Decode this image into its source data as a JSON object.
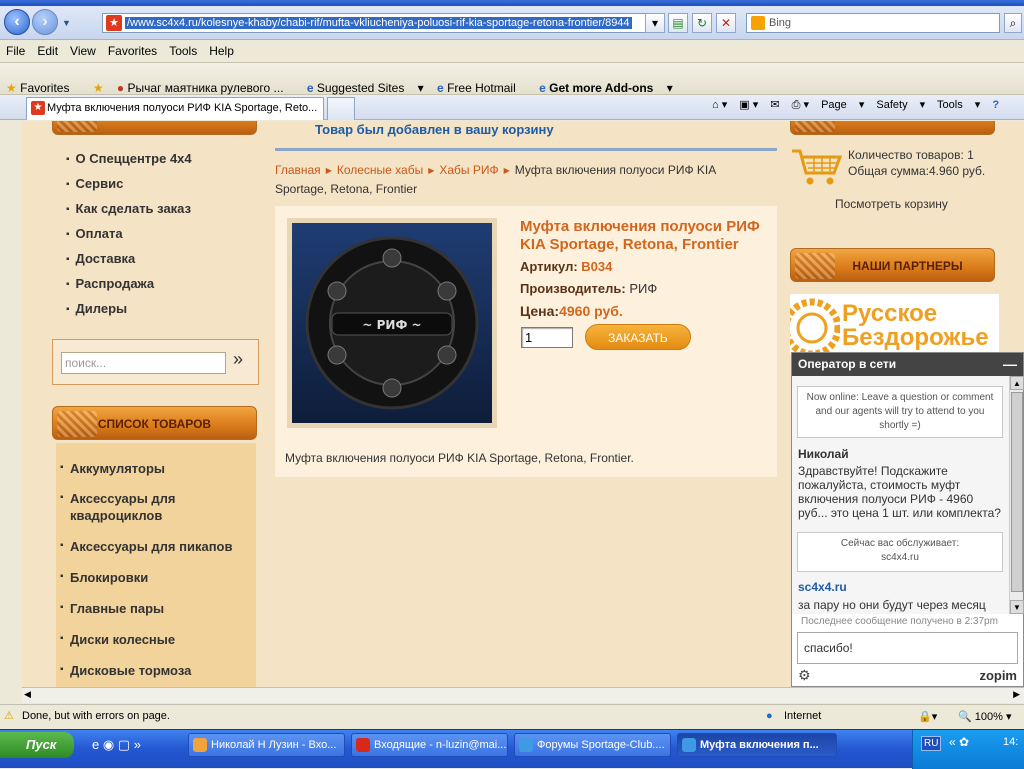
{
  "browser": {
    "url_prefix": "/www.sc4x4.ru/kolesnye-khaby/chabi-rif/mufta-vkliucheniya-poluosi-rif-kia-sportage-retona-frontier/8944",
    "search_placeholder": "Bing",
    "menu": [
      "File",
      "Edit",
      "View",
      "Favorites",
      "Tools",
      "Help"
    ],
    "favorites": {
      "favorites_label": "Favorites",
      "items": [
        "Рычаг маятника рулевого ...",
        "Suggested Sites",
        "Free Hotmail",
        "Get more Add-ons"
      ]
    },
    "tab_title": "Муфта включения полуоси РИФ KIA Sportage, Reto...",
    "commands": [
      "Page",
      "Safety",
      "Tools"
    ]
  },
  "site": {
    "left_nav": [
      "О Спеццентре 4х4",
      "Сервис",
      "Как сделать заказ",
      "Оплата",
      "Доставка",
      "Распродажа",
      "Дилеры"
    ],
    "search_placeholder": "поиск...",
    "search_go": "»",
    "goods_header": "СПИСОК ТОВАРОВ",
    "goods": [
      "Аккумуляторы",
      "Аксессуары для квадроциклов",
      "Аксессуары для пикапов",
      "Блокировки",
      "Главные пары",
      "Диски колесные",
      "Дисковые тормоза"
    ],
    "cart_added": "Товар был добавлен в вашу корзину",
    "breadcrumbs": [
      "Главная",
      "Колесные хабы",
      "Хабы РИФ"
    ],
    "breadcrumb_current": "Муфта включения полуоси РИФ KIA Sportage, Retona, Frontier",
    "product": {
      "title": "Муфта включения полуоси РИФ KIA Sportage, Retona, Frontier",
      "sku_label": "Артикул:",
      "sku": "B034",
      "maker_label": "Производитель:",
      "maker": "РИФ",
      "price_label": "Цена:",
      "price": "4960 руб.",
      "qty": "1",
      "order_button": "ЗАКАЗАТЬ",
      "description": "Муфта включения полуоси РИФ KIA Sportage, Retona, Frontier.",
      "image_text": "~ РИФ ~"
    },
    "cart": {
      "count": "Количество товаров: 1",
      "total": "Общая сумма:4.960 руб.",
      "view_cart": "Посмотреть корзину"
    },
    "partners_header": "НАШИ ПАРТНЕРЫ",
    "partner_banner_line1": "Русское",
    "partner_banner_line2": "Бездорожье"
  },
  "chat": {
    "header": "Оператор в сети",
    "intro": "Now online: Leave a question or comment and our agents will try to attend to you shortly =)",
    "user_name": "Николай",
    "user_message": "Здравствуйте! Подскажите пожалуйста, стоимость муфт включения полуоси РИФ - 4960 руб... это цена 1 шт. или комплекта?",
    "served_label": "Сейчас вас обслуживает:",
    "served_by": "sc4x4.ru",
    "agent_name": "sc4x4.ru",
    "agent_message": "за пару но они будут через месяц",
    "last_message": "Последнее сообщение получено в 2:37pm",
    "input_value": "спасибо!",
    "brand": "zopim"
  },
  "status": {
    "text": "Done, but with errors on page.",
    "zone": "Internet",
    "zoom": "100%"
  },
  "taskbar": {
    "start": "Пуск",
    "tasks": [
      "Николай Н Лузин - Вхо...",
      "Входящие - n-luzin@mai...",
      "Форумы Sportage-Club....",
      "Муфта включения п..."
    ],
    "lang": "RU",
    "clock": "14:"
  },
  "colors": {
    "accent_orange": "#d3651d",
    "link_blue": "#1d5ca6",
    "page_bg": "#f5e3c6"
  }
}
